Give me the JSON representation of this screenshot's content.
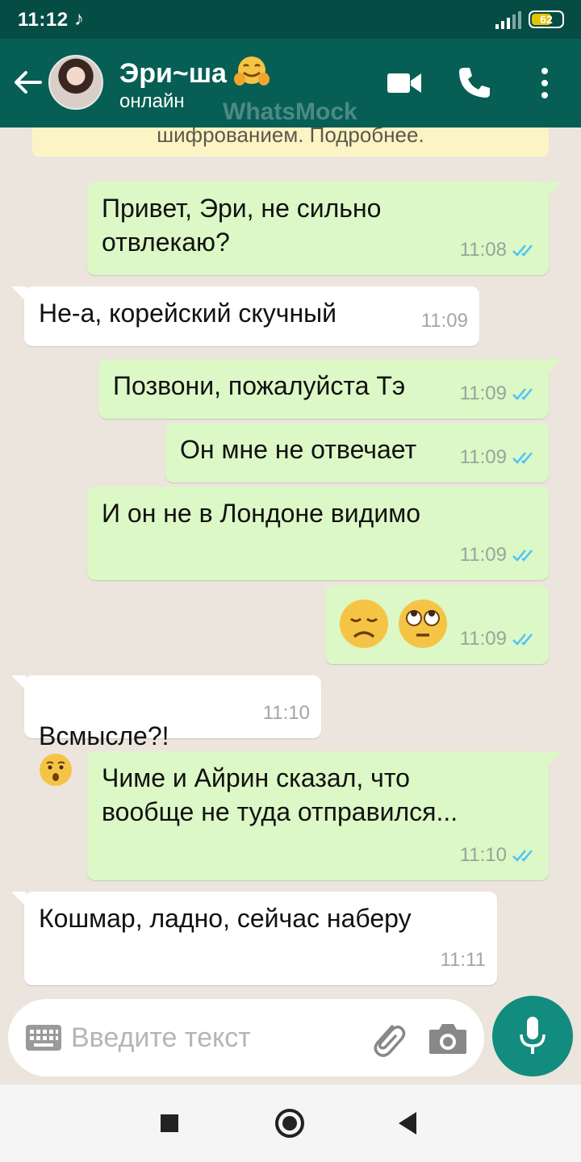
{
  "status_bar": {
    "time": "11:12",
    "battery": "62"
  },
  "header": {
    "name": "Эри~ша",
    "status": "онлайн",
    "watermark": "WhatsMock"
  },
  "encryption_notice": "шифрованием. Подробнее.",
  "messages": [
    {
      "direction": "out",
      "text": "Привет, Эри, не сильно\nотвлекаю?",
      "time": "11:08",
      "read": true
    },
    {
      "direction": "in",
      "text": "Не-а, корейский скучный",
      "time": "11:09"
    },
    {
      "direction": "out",
      "text": "Позвони, пожалуйста Тэ",
      "time": "11:09",
      "read": true
    },
    {
      "direction": "out",
      "text": "Он мне не отвечает",
      "time": "11:09",
      "read": true
    },
    {
      "direction": "out",
      "text": "И он не в Лондоне видимо",
      "time": "11:09",
      "read": true
    },
    {
      "direction": "out",
      "emojis": [
        "disappointed-face",
        "face-with-rolling-eyes"
      ],
      "time": "11:09",
      "read": true
    },
    {
      "direction": "in",
      "text": "Всмысле?!",
      "emojis": [
        "hushed-face"
      ],
      "time": "11:10"
    },
    {
      "direction": "out",
      "text": "Чиме и Айрин сказал, что\nвообще не туда отправился...",
      "time": "11:10",
      "read": true
    },
    {
      "direction": "in",
      "text": "Кошмар, ладно, сейчас наберу",
      "time": "11:11"
    }
  ],
  "composer": {
    "placeholder": "Введите текст"
  },
  "icons": {
    "back": "arrow-left-icon",
    "video": "video-call-icon",
    "call": "phone-icon",
    "menu": "more-vert-icon",
    "keyboard": "keyboard-icon",
    "attach": "paperclip-icon",
    "camera": "camera-icon",
    "mic": "mic-icon"
  },
  "colors": {
    "header": "#075e54",
    "statusbar": "#054c44",
    "outgoing_bubble": "#dcf8c6",
    "incoming_bubble": "#ffffff",
    "read_ticks": "#4fc3f7",
    "mic_button": "#128c7e",
    "chat_background": "#ece5dd"
  }
}
